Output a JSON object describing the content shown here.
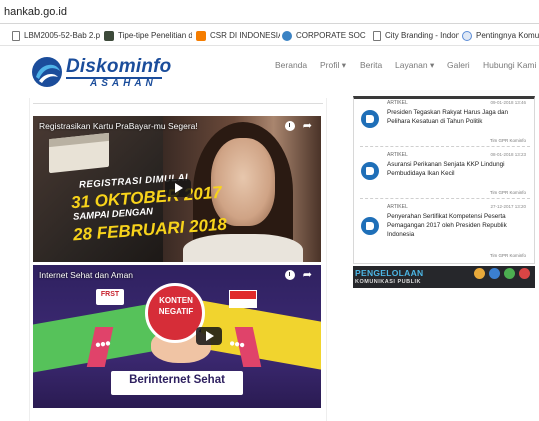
{
  "browser": {
    "url": "hankab.go.id",
    "bookmarks": [
      {
        "label": "LBM2005-52-Bab 2.p",
        "icon": "page-icon"
      },
      {
        "label": "Tipe-tipe Penelitian d",
        "icon": "image-icon"
      },
      {
        "label": "CSR DI INDONESIA S",
        "icon": "blogger-icon"
      },
      {
        "label": "CORPORATE SOCIAL",
        "icon": "globe-icon"
      },
      {
        "label": "City Branding - Indon",
        "icon": "page-icon"
      },
      {
        "label": "Pentingnya Komuni",
        "icon": "circle-icon"
      }
    ]
  },
  "site": {
    "logo": {
      "name_a": "Disko",
      "name_b": "minfo",
      "sub": "ASAHAN"
    },
    "nav": [
      "Beranda",
      "Profil ▾",
      "Berita",
      "Layanan ▾",
      "Galeri",
      "Hubungi Kami"
    ]
  },
  "videos": [
    {
      "title": "Registrasikan Kartu PraBayar-mu Segera!",
      "overlay": [
        "REGISTRASI DIMULAI",
        "31 OKTOBER 2017",
        "SAMPAI DENGAN",
        "28 FEBRUARI 2018"
      ]
    },
    {
      "title": "Internet Sehat dan Aman",
      "badge": [
        "KONTEN",
        "NEGATIF"
      ],
      "frst": "FRST",
      "ribbon": "Berinternet Sehat"
    }
  ],
  "articles": [
    {
      "kind": "ARTIKEL",
      "date": "09-01-2018 13:46",
      "title": "Presiden Tegaskan Rakyat Harus Jaga dan Pelihara Kesatuan di Tahun Politik",
      "author": "Tim GPR Kominfo"
    },
    {
      "kind": "ARTIKEL",
      "date": "08-01-2018 13:23",
      "title": "Asuransi Perikanan Senjata KKP Lindungi Pembudidaya Ikan Kecil",
      "author": "Tim GPR Kominfo"
    },
    {
      "kind": "ARTIKEL",
      "date": "27-12-2017 13:20",
      "title": "Penyerahan Sertifikat Kompetensi Peserta Pemagangan 2017 oleh Presiden Republik Indonesia",
      "author": "Tim GPR Kominfo"
    }
  ],
  "banner": {
    "title": "PENGELOLAAN",
    "sub": "KOMUNIKASI PUBLIK"
  }
}
